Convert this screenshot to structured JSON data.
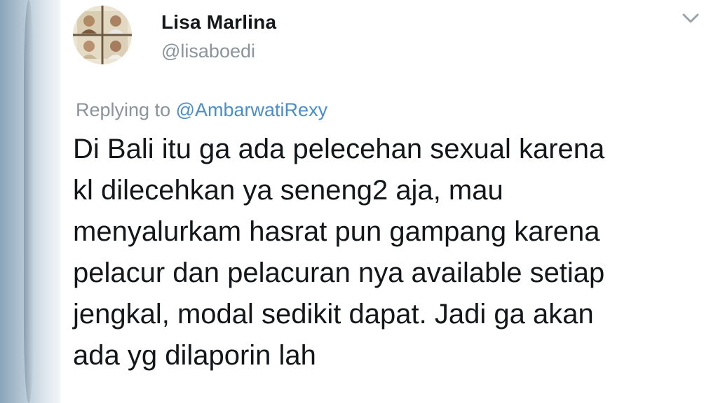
{
  "tweet": {
    "author": {
      "name": "Lisa Marlina",
      "handle": "@lisaboedi",
      "avatar_icon": "profile-photo-collage"
    },
    "menu_icon": "chevron-down-icon",
    "reply_context": {
      "prefix": "Replying to",
      "mention": "@AmbarwatiRexy"
    },
    "text_lines": [
      "Di Bali itu ga ada pelecehan sexual karena",
      "kl dilecehkan ya seneng2 aja,  mau",
      "menyalurkam hasrat pun gampang karena",
      "pelacur dan pelacuran nya available setiap",
      "jengkal, modal sedikit dapat.  Jadi ga akan",
      "ada yg dilaporin lah"
    ]
  },
  "colors": {
    "text_primary": "#14171a",
    "text_secondary": "#8a949c",
    "mention": "#4a8ec9",
    "background": "#ffffff"
  }
}
